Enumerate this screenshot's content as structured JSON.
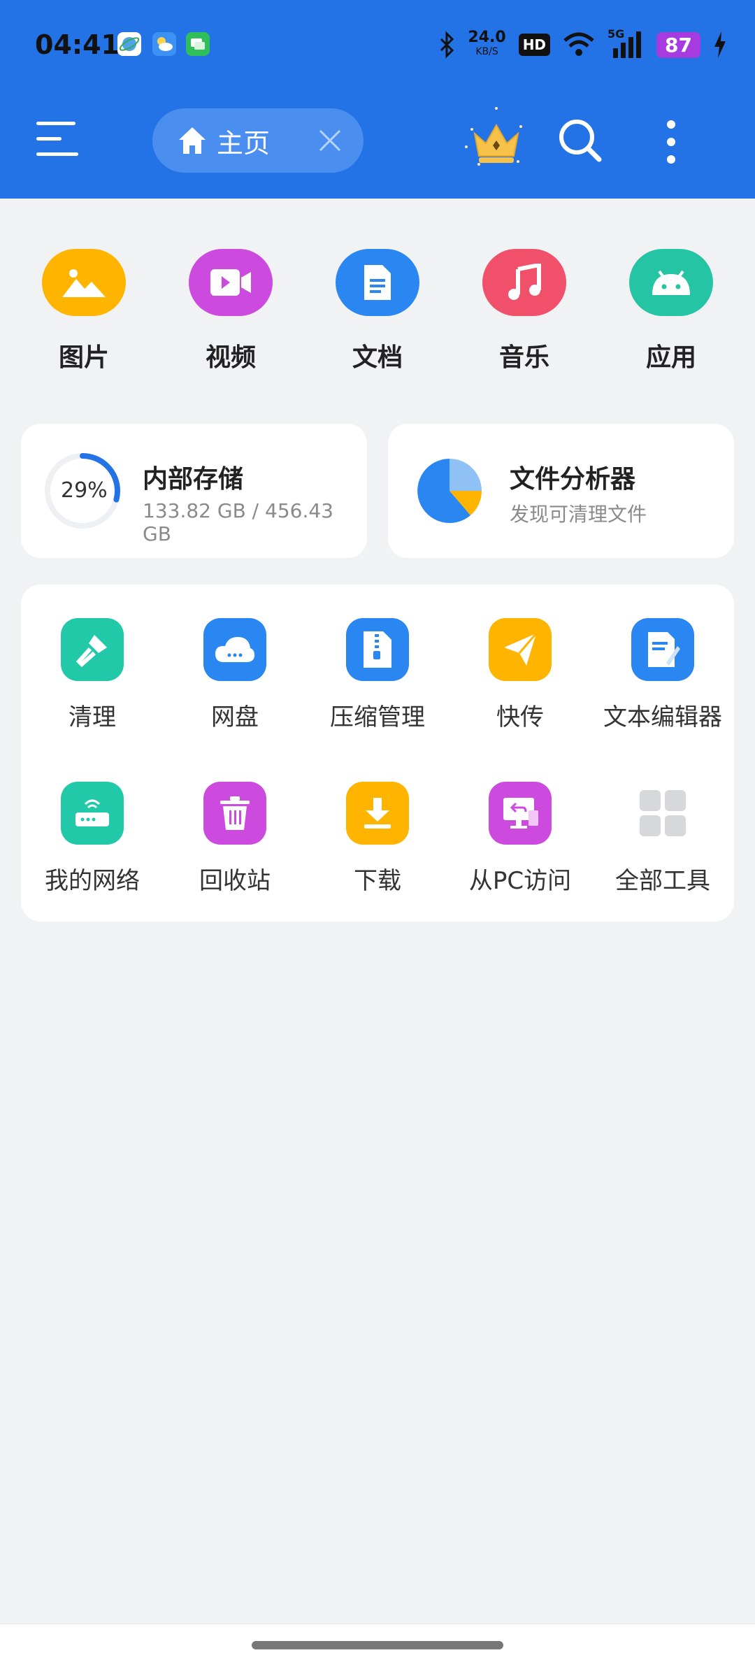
{
  "status_bar": {
    "time": "04:41",
    "net_speed": "24.0",
    "net_unit": "KB/S",
    "hd_badge": "HD",
    "signal_label": "5G",
    "battery": "87"
  },
  "toolbar": {
    "tab_label": "主页",
    "menu_icon": "hamburger-menu-icon",
    "crown_icon": "crown-icon",
    "search_icon": "search-icon",
    "more_icon": "more-vertical-icon"
  },
  "categories": [
    {
      "label": "图片",
      "icon": "image-icon",
      "color": "#ffb400"
    },
    {
      "label": "视频",
      "icon": "video-icon",
      "color": "#cc4ade"
    },
    {
      "label": "文档",
      "icon": "document-icon",
      "color": "#2a86f0"
    },
    {
      "label": "音乐",
      "icon": "music-icon",
      "color": "#f0506a"
    },
    {
      "label": "应用",
      "icon": "android-icon",
      "color": "#24c4a4"
    }
  ],
  "storage": {
    "title": "内部存储",
    "percent_label": "29%",
    "percent_value": 29,
    "usage": "133.82 GB / 456.43 GB"
  },
  "analyzer": {
    "title": "文件分析器",
    "subtitle": "发现可清理文件"
  },
  "tools": [
    {
      "label": "清理",
      "icon": "broom-icon",
      "color": "#22c9a8"
    },
    {
      "label": "网盘",
      "icon": "cloud-drive-icon",
      "color": "#2a86f0"
    },
    {
      "label": "压缩管理",
      "icon": "zip-file-icon",
      "color": "#2a86f0"
    },
    {
      "label": "快传",
      "icon": "paper-plane-icon",
      "color": "#ffb400"
    },
    {
      "label": "文本编辑器",
      "icon": "text-edit-icon",
      "color": "#2a86f0"
    },
    {
      "label": "我的网络",
      "icon": "router-icon",
      "color": "#22c9a8"
    },
    {
      "label": "回收站",
      "icon": "trash-icon",
      "color": "#cc4ade"
    },
    {
      "label": "下载",
      "icon": "download-icon",
      "color": "#ffb400"
    },
    {
      "label": "从PC访问",
      "icon": "pc-access-icon",
      "color": "#cc4ade"
    },
    {
      "label": "全部工具",
      "icon": "grid-icon",
      "color": "#d6d8dc"
    }
  ]
}
